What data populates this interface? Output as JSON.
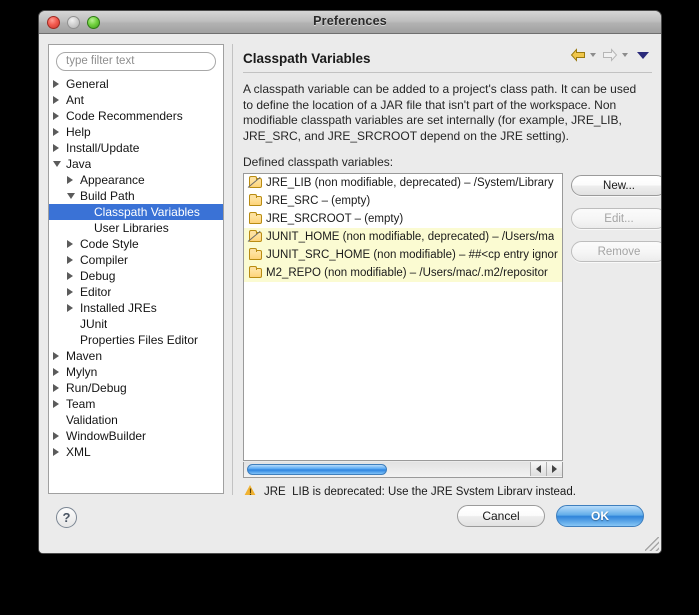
{
  "window": {
    "title": "Preferences",
    "traffic_lights": [
      "close",
      "minimize",
      "zoom"
    ]
  },
  "sidebar": {
    "filter_placeholder": "type filter text",
    "filter_value": "",
    "items": [
      {
        "label": "General",
        "indent": 0,
        "twisty": "collapsed",
        "selected": false
      },
      {
        "label": "Ant",
        "indent": 0,
        "twisty": "collapsed",
        "selected": false
      },
      {
        "label": "Code Recommenders",
        "indent": 0,
        "twisty": "collapsed",
        "selected": false
      },
      {
        "label": "Help",
        "indent": 0,
        "twisty": "collapsed",
        "selected": false
      },
      {
        "label": "Install/Update",
        "indent": 0,
        "twisty": "collapsed",
        "selected": false
      },
      {
        "label": "Java",
        "indent": 0,
        "twisty": "expanded",
        "selected": false
      },
      {
        "label": "Appearance",
        "indent": 1,
        "twisty": "collapsed",
        "selected": false
      },
      {
        "label": "Build Path",
        "indent": 1,
        "twisty": "expanded",
        "selected": false
      },
      {
        "label": "Classpath Variables",
        "indent": 2,
        "twisty": "none",
        "selected": true
      },
      {
        "label": "User Libraries",
        "indent": 2,
        "twisty": "none",
        "selected": false
      },
      {
        "label": "Code Style",
        "indent": 1,
        "twisty": "collapsed",
        "selected": false
      },
      {
        "label": "Compiler",
        "indent": 1,
        "twisty": "collapsed",
        "selected": false
      },
      {
        "label": "Debug",
        "indent": 1,
        "twisty": "collapsed",
        "selected": false
      },
      {
        "label": "Editor",
        "indent": 1,
        "twisty": "collapsed",
        "selected": false
      },
      {
        "label": "Installed JREs",
        "indent": 1,
        "twisty": "collapsed",
        "selected": false
      },
      {
        "label": "JUnit",
        "indent": 1,
        "twisty": "none",
        "selected": false
      },
      {
        "label": "Properties Files Editor",
        "indent": 1,
        "twisty": "none",
        "selected": false
      },
      {
        "label": "Maven",
        "indent": 0,
        "twisty": "collapsed",
        "selected": false
      },
      {
        "label": "Mylyn",
        "indent": 0,
        "twisty": "collapsed",
        "selected": false
      },
      {
        "label": "Run/Debug",
        "indent": 0,
        "twisty": "collapsed",
        "selected": false
      },
      {
        "label": "Team",
        "indent": 0,
        "twisty": "collapsed",
        "selected": false
      },
      {
        "label": "Validation",
        "indent": 0,
        "twisty": "none",
        "selected": false
      },
      {
        "label": "WindowBuilder",
        "indent": 0,
        "twisty": "collapsed",
        "selected": false
      },
      {
        "label": "XML",
        "indent": 0,
        "twisty": "collapsed",
        "selected": false
      }
    ]
  },
  "page": {
    "title": "Classpath Variables",
    "nav": {
      "back_icon": "back-arrow-icon",
      "back_menu_icon": "chevron-down-icon",
      "forward_icon": "forward-arrow-icon",
      "forward_menu_icon": "chevron-down-icon",
      "menu_icon": "triangle-down-icon"
    },
    "description": "A classpath variable can be added to a project's class path. It can be used to define the location of a JAR file that isn't part of the workspace. Non modifiable classpath variables are set internally (for example, JRE_LIB, JRE_SRC, and JRE_SRCROOT depend on the JRE setting).",
    "defined_label": "Defined classpath variables:",
    "variables": [
      {
        "text": "JRE_LIB (non modifiable, deprecated) – /System/Library",
        "icon": "folder-deprecated-icon",
        "highlighted": false
      },
      {
        "text": "JRE_SRC – (empty)",
        "icon": "folder-icon",
        "highlighted": false
      },
      {
        "text": "JRE_SRCROOT – (empty)",
        "icon": "folder-icon",
        "highlighted": false
      },
      {
        "text": "JUNIT_HOME (non modifiable, deprecated) – /Users/ma",
        "icon": "folder-deprecated-icon",
        "highlighted": true
      },
      {
        "text": "JUNIT_SRC_HOME (non modifiable) – ##<cp entry ignor",
        "icon": "folder-icon",
        "highlighted": true
      },
      {
        "text": "M2_REPO (non modifiable) – /Users/mac/.m2/repositor",
        "icon": "folder-icon",
        "highlighted": true
      }
    ],
    "buttons": {
      "new": {
        "label": "New...",
        "enabled": true
      },
      "edit": {
        "label": "Edit...",
        "enabled": false
      },
      "remove": {
        "label": "Remove",
        "enabled": false
      }
    },
    "scrollbar": {
      "left_arrow_icon": "arrow-left-icon",
      "right_arrow_icon": "arrow-right-icon"
    },
    "warning": {
      "icon": "warning-triangle-icon",
      "text": "JRE_LIB is deprecated: Use the JRE System Library instead."
    }
  },
  "footer": {
    "help_label": "?",
    "cancel_label": "Cancel",
    "ok_label": "OK"
  },
  "colors": {
    "selection_blue": "#3a72d6",
    "highlight_yellow": "#fbfbd2",
    "default_button_blue": "#2f84da",
    "warning_amber": "#f0b232",
    "folder_gold": "#fdd379"
  }
}
